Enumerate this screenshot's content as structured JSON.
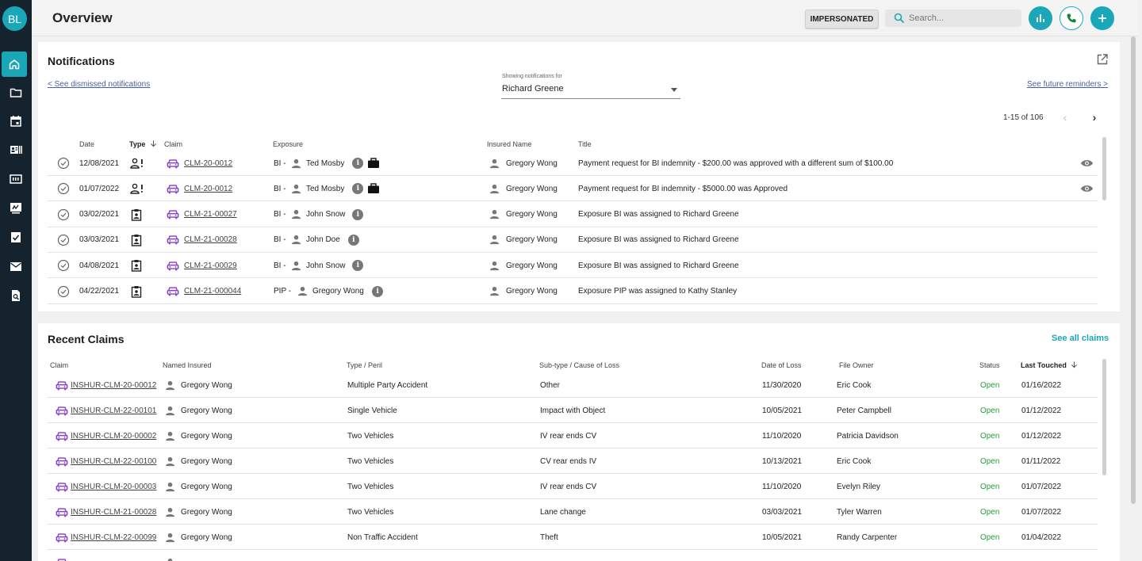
{
  "app": {
    "user_initials": "BL",
    "page_title": "Overview",
    "impersonated_label": "IMPERSONATED",
    "search_placeholder": "Search...",
    "accent": "#1aa8b8"
  },
  "sidebar": {
    "items": [
      {
        "icon": "home-icon",
        "active": true
      },
      {
        "icon": "folder-icon"
      },
      {
        "icon": "calendar-icon"
      },
      {
        "icon": "contact-card-icon"
      },
      {
        "icon": "counter-icon"
      },
      {
        "icon": "signature-icon"
      },
      {
        "icon": "task-check-icon"
      },
      {
        "icon": "mail-icon"
      },
      {
        "icon": "document-search-icon"
      }
    ]
  },
  "notifications": {
    "title": "Notifications",
    "dismissed_link": "< See dismissed notifications",
    "future_link": "See future reminders >",
    "select_label": "Showing notifications for",
    "select_value": "Richard Greene",
    "pager": "1-15 of 106",
    "columns": {
      "date": "Date",
      "type": "Type",
      "claim": "Claim",
      "exposure": "Exposure",
      "insured": "Insured Name",
      "title": "Title"
    },
    "rows": [
      {
        "date": "12/08/2021",
        "type": "person-alert",
        "claim": "CLM-20-0012",
        "exp_prefix": "BI -",
        "exp_name": "Ted Mosby",
        "briefcase": true,
        "insured": "Gregory Wong",
        "title": "Payment request for BI indemnity - $200.00 was approved with a different sum of $100.00",
        "title_person": "",
        "eye": true
      },
      {
        "date": "01/07/2022",
        "type": "person-alert",
        "claim": "CLM-20-0012",
        "exp_prefix": "BI -",
        "exp_name": "Ted Mosby",
        "briefcase": true,
        "insured": "Gregory Wong",
        "title": "Payment request for BI indemnity - $5000.00 was Approved",
        "title_person": "",
        "eye": true
      },
      {
        "date": "03/02/2021",
        "type": "clipboard-person",
        "claim": "CLM-21-00027",
        "exp_prefix": "BI -",
        "exp_name": "John Snow",
        "briefcase": false,
        "insured": "Gregory Wong",
        "title": "Exposure BI was assigned to",
        "title_person": "Richard Greene",
        "eye": false
      },
      {
        "date": "03/03/2021",
        "type": "clipboard-person",
        "claim": "CLM-21-00028",
        "exp_prefix": "BI -",
        "exp_name": "John Doe",
        "briefcase": false,
        "insured": "Gregory Wong",
        "title": "Exposure BI was assigned to",
        "title_person": "Richard Greene",
        "eye": false
      },
      {
        "date": "04/08/2021",
        "type": "clipboard-person",
        "claim": "CLM-21-00029",
        "exp_prefix": "BI -",
        "exp_name": "John Snow",
        "briefcase": false,
        "insured": "Gregory Wong",
        "title": "Exposure BI was assigned to",
        "title_person": "Richard Greene",
        "eye": false
      },
      {
        "date": "04/22/2021",
        "type": "clipboard-person",
        "claim": "CLM-21-000044",
        "exp_prefix": "PIP -",
        "exp_name": "Gregory Wong",
        "briefcase": false,
        "insured": "Gregory Wong",
        "title": "Exposure PIP was assigned to",
        "title_person": "Kathy Stanley",
        "eye": false
      }
    ]
  },
  "claims": {
    "title": "Recent Claims",
    "see_all": "See all claims",
    "columns": {
      "claim": "Claim",
      "insured": "Named Insured",
      "type": "Type / Peril",
      "subtype": "Sub-type / Cause of Loss",
      "date": "Date of Loss",
      "owner": "File Owner",
      "status": "Status",
      "touched": "Last Touched"
    },
    "rows": [
      {
        "claim": "INSHUR-CLM-20-00012",
        "insured": "Gregory Wong",
        "type": "Multiple Party Accident",
        "subtype": "Other",
        "date": "11/30/2020",
        "owner": "Eric Cook",
        "status": "Open",
        "touched": "01/16/2022"
      },
      {
        "claim": "INSHUR-CLM-22-00101",
        "insured": "Gregory Wong",
        "type": "Single Vehicle",
        "subtype": "Impact with Object",
        "date": "10/05/2021",
        "owner": "Peter Campbell",
        "status": "Open",
        "touched": "01/12/2022"
      },
      {
        "claim": "INSHUR-CLM-20-00002",
        "insured": "Gregory Wong",
        "type": "Two Vehicles",
        "subtype": "IV rear ends CV",
        "date": "11/10/2020",
        "owner": "Patricia Davidson",
        "status": "Open",
        "touched": "01/12/2022"
      },
      {
        "claim": "INSHUR-CLM-22-00100",
        "insured": "Gregory Wong",
        "type": "Two Vehicles",
        "subtype": "CV rear ends IV",
        "date": "10/13/2021",
        "owner": "Eric Cook",
        "status": "Open",
        "touched": "01/11/2022"
      },
      {
        "claim": "INSHUR-CLM-20-00003",
        "insured": "Gregory Wong",
        "type": "Two Vehicles",
        "subtype": "IV rear ends CV",
        "date": "11/10/2020",
        "owner": "Evelyn Riley",
        "status": "Open",
        "touched": "01/07/2022"
      },
      {
        "claim": "INSHUR-CLM-21-00028",
        "insured": "Gregory Wong",
        "type": "Two Vehicles",
        "subtype": "Lane change",
        "date": "03/03/2021",
        "owner": "Tyler Warren",
        "status": "Open",
        "touched": "01/07/2022"
      },
      {
        "claim": "INSHUR-CLM-22-00099",
        "insured": "Gregory Wong",
        "type": "Non Traffic Accident",
        "subtype": "Theft",
        "date": "10/05/2021",
        "owner": "Randy Carpenter",
        "status": "Open",
        "touched": "01/04/2022"
      }
    ]
  }
}
